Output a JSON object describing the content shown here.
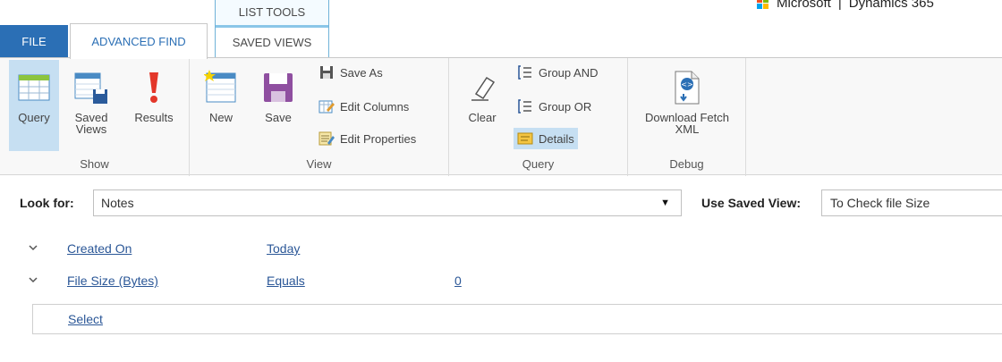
{
  "tabs": {
    "file": "FILE",
    "advanced_find": "ADVANCED FIND",
    "context_group": "LIST TOOLS",
    "saved_views": "SAVED VIEWS"
  },
  "brand": {
    "company": "Microsoft",
    "separator": "|",
    "product": "Dynamics 365",
    "logo_colors": [
      "#f25022",
      "#7fba00",
      "#00a4ef",
      "#ffb900"
    ]
  },
  "ribbon": {
    "show": {
      "label": "Show",
      "query": "Query",
      "saved_views": "Saved Views",
      "results": "Results"
    },
    "view": {
      "label": "View",
      "new": "New",
      "save": "Save",
      "save_as": "Save As",
      "edit_columns": "Edit Columns",
      "edit_properties": "Edit Properties"
    },
    "query": {
      "label": "Query",
      "clear": "Clear",
      "group_and": "Group AND",
      "group_or": "Group OR",
      "details": "Details"
    },
    "debug": {
      "label": "Debug",
      "download_fetch_xml": "Download Fetch XML"
    }
  },
  "lookfor": {
    "label": "Look for:",
    "value": "Notes",
    "arrow": "▼",
    "saved_view_label": "Use Saved View:",
    "saved_view_value": "To Check file Size"
  },
  "criteria": [
    {
      "field": "Created On",
      "operator": "Today",
      "value": ""
    },
    {
      "field": "File Size (Bytes)",
      "operator": "Equals",
      "value": "0"
    }
  ],
  "select_link": "Select",
  "colors": {
    "accent": "#2b6fb5",
    "link": "#2b5797",
    "selected": "#c6dff2"
  }
}
